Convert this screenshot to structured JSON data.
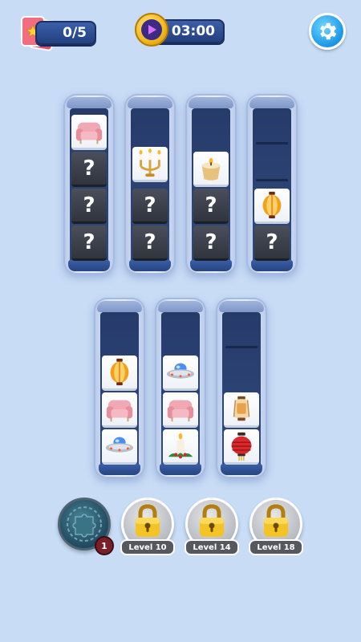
{
  "hud": {
    "cards_progress": "0/5",
    "timer": "03:00"
  },
  "colors": {
    "background": "#c8dcf6",
    "pill": "#2b4a8c",
    "hidden_tile": "#3a3e48",
    "settings": "#1f9be8"
  },
  "columns": [
    {
      "id": 1,
      "tiles": [
        "sofa",
        "?",
        "?",
        "?"
      ]
    },
    {
      "id": 2,
      "tiles": [
        "candelabra",
        "?",
        "?"
      ]
    },
    {
      "id": 3,
      "tiles": [
        "candle",
        "?",
        "?"
      ]
    },
    {
      "id": 4,
      "tiles": [
        "lantern",
        "?"
      ]
    },
    {
      "id": 5,
      "tiles": [
        "lantern",
        "sofa",
        "ufo"
      ]
    },
    {
      "id": 6,
      "tiles": [
        "ufo",
        "sofa",
        "candle-holly"
      ]
    },
    {
      "id": 7,
      "tiles": [
        "paper-lantern",
        "red-lantern"
      ]
    }
  ],
  "hidden_tile_symbol": "?",
  "boosters": {
    "shuffle": {
      "icon": "puzzle-shuffle-icon",
      "count": "1"
    },
    "locked": [
      {
        "label": "Level 10",
        "icon": "padlock-icon"
      },
      {
        "label": "Level 14",
        "icon": "padlock-icon"
      },
      {
        "label": "Level 18",
        "icon": "padlock-icon"
      }
    ]
  }
}
